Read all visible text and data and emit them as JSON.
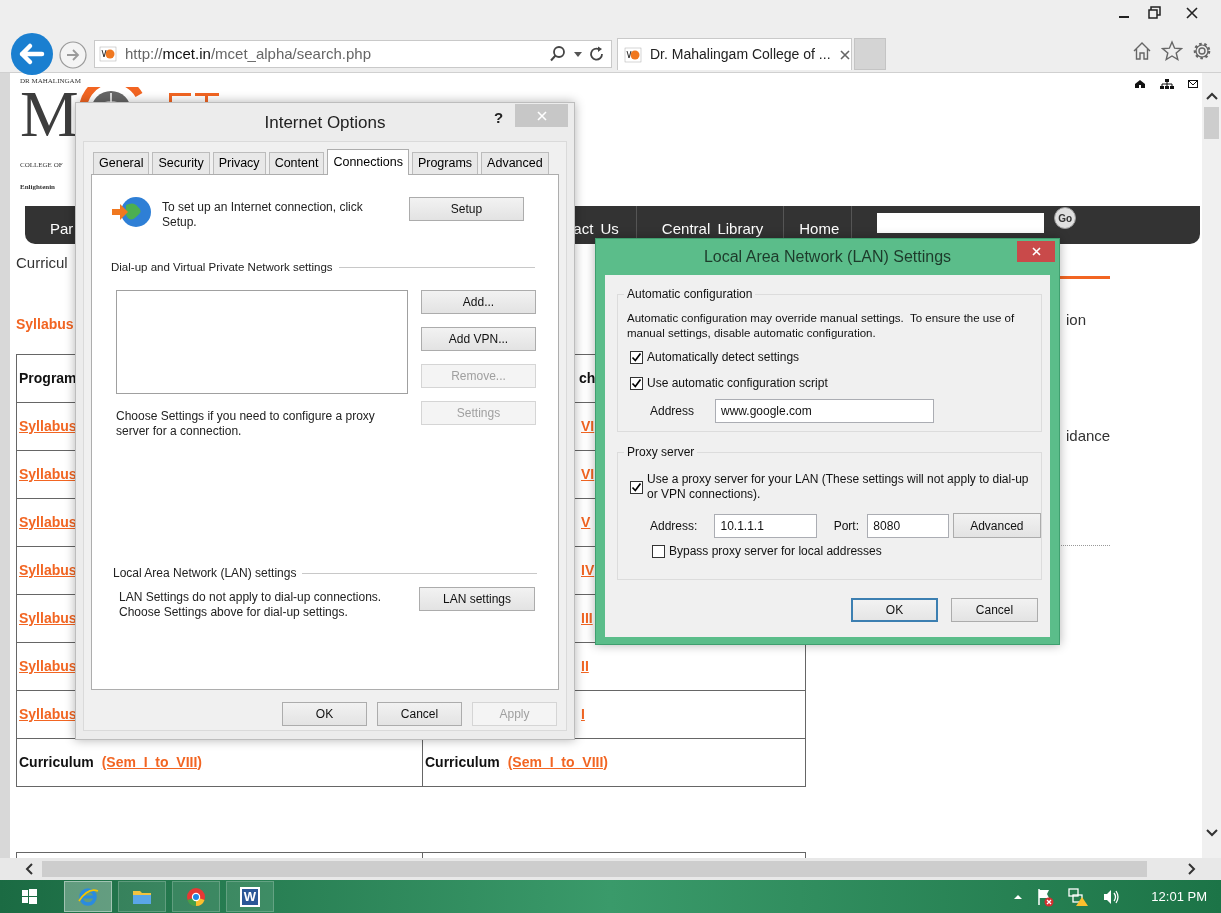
{
  "browser": {
    "address": "http://**mcet.in**/mcet_alpha/search.php",
    "tab": {
      "title": "Dr. Mahalingam College of ...",
      "selected": true
    }
  },
  "web_page": {
    "logo": {
      "top_line": "DR MAHALINGAM",
      "letter": "M",
      "line_2": "COLLEGE OF",
      "line_3": "Enlightenin"
    },
    "nav": [
      "Par",
      "act Us",
      "Central Library",
      "Home"
    ],
    "search_button": "Go",
    "heading": "Curricul",
    "link": "Syllabus",
    "side_texts": [
      "ion",
      "idance"
    ],
    "table_rows": [
      {
        "kind": "header",
        "left": "Program",
        "right": "ch"
      },
      {
        "kind": "link",
        "left": "Syllabus",
        "right": "VI"
      },
      {
        "kind": "link",
        "left": "Syllabus",
        "right": "VI"
      },
      {
        "kind": "link",
        "left": "Syllabus",
        "right": "V"
      },
      {
        "kind": "link",
        "left": "Syllabus",
        "right": "IV"
      },
      {
        "kind": "link",
        "left": "Syllabus",
        "right": "III"
      },
      {
        "kind": "link",
        "left": "Syllabus",
        "right": "II"
      },
      {
        "kind": "link",
        "left": "Syllabus",
        "right": "I"
      },
      {
        "kind": "curriculum",
        "left": "Curriculum",
        "left_link": "(Sem  I  to  VIII)",
        "right": "Curriculum",
        "right_link": "(Sem  I  to  VIII)"
      }
    ]
  },
  "internet_options": {
    "title": "Internet Options",
    "help": "?",
    "tabs": [
      {
        "label": "General",
        "selected": false
      },
      {
        "label": "Security",
        "selected": false
      },
      {
        "label": "Privacy",
        "selected": false
      },
      {
        "label": "Content",
        "selected": false
      },
      {
        "label": "Connections",
        "selected": true
      },
      {
        "label": "Programs",
        "selected": false
      },
      {
        "label": "Advanced",
        "selected": false
      }
    ],
    "setup": {
      "text": "To set up an Internet connection, click Setup.",
      "button": "Setup"
    },
    "dialup": {
      "heading": "Dial-up and Virtual Private Network settings",
      "buttons": [
        {
          "label": "Add...",
          "disabled": false
        },
        {
          "label": "Add VPN...",
          "disabled": false
        },
        {
          "label": "Remove...",
          "disabled": true
        },
        {
          "label": "Settings",
          "disabled": true
        }
      ],
      "note": "Choose Settings if you need to configure a proxy server for a connection."
    },
    "lan": {
      "heading": "Local Area Network (LAN) settings",
      "note": "LAN Settings do not apply to dial-up connections. Choose Settings above for dial-up settings.",
      "button": "LAN settings"
    },
    "buttons": [
      {
        "label": "OK",
        "disabled": false
      },
      {
        "label": "Cancel",
        "disabled": false
      },
      {
        "label": "Apply",
        "disabled": true
      }
    ]
  },
  "lan_settings": {
    "title": "Local Area Network (LAN) Settings",
    "auto": {
      "heading": "Automatic configuration",
      "note": "Automatic configuration may override manual settings.  To ensure the use of manual settings, disable automatic configuration.",
      "options": [
        {
          "label": "Automatically detect settings",
          "checked": true
        },
        {
          "label": "Use automatic configuration script",
          "checked": true
        }
      ],
      "address_label": "Address",
      "address": "www.google.com"
    },
    "proxy": {
      "heading": "Proxy server",
      "use": {
        "label": "Use a proxy server for your LAN (These settings will not apply to dial-up or VPN connections).",
        "checked": true
      },
      "address_label": "Address:",
      "address": "10.1.1.1",
      "port_label": "Port:",
      "port": "8080",
      "advanced": "Advanced",
      "bypass": {
        "label": "Bypass proxy server for local addresses",
        "checked": false
      }
    },
    "buttons": [
      {
        "label": "OK",
        "default": true
      },
      {
        "label": "Cancel",
        "default": false
      }
    ]
  },
  "taskbar": {
    "apps": [
      {
        "kind": "ie",
        "selected": true
      },
      {
        "kind": "explorer",
        "selected": false
      },
      {
        "kind": "chrome",
        "selected": false
      },
      {
        "kind": "word",
        "label": "W",
        "selected": false
      }
    ],
    "clock": "12:01 PM"
  }
}
